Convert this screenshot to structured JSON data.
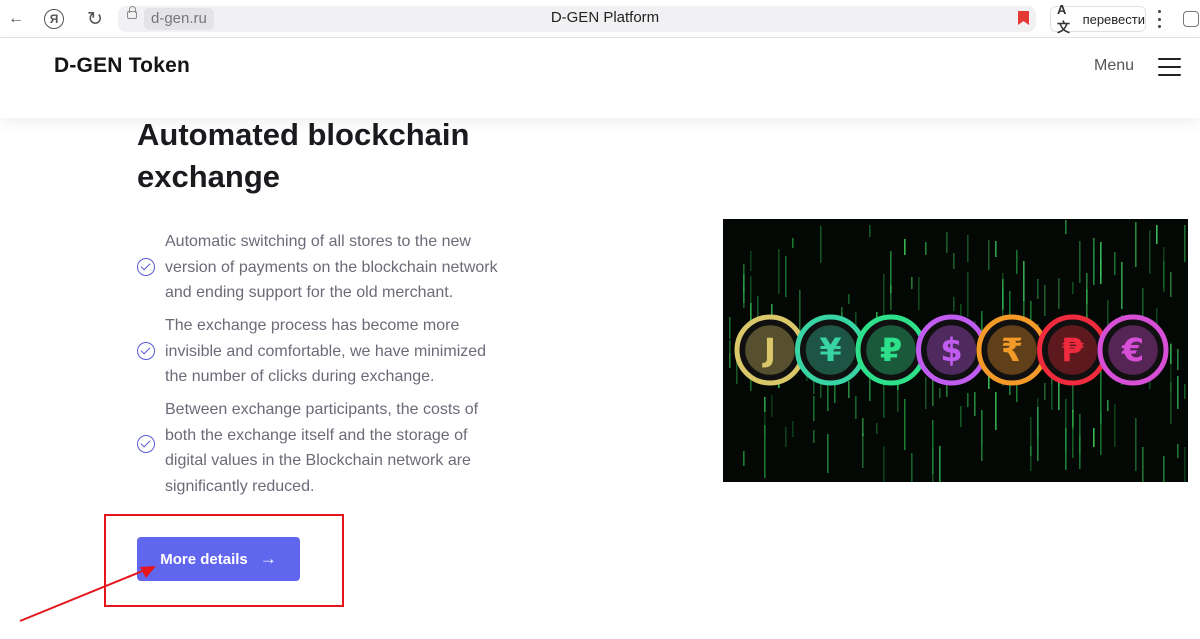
{
  "browser": {
    "url_domain": "d-gen.ru",
    "tab_title": "D-GEN Platform",
    "translate_label": "перевести",
    "translate_glyph": "A文",
    "back_glyph": "←",
    "reload_glyph": "↻",
    "yandex_glyph": "Я"
  },
  "header": {
    "logo": "D-GEN Token",
    "menu_label": "Menu"
  },
  "main": {
    "heading_line1": "Automated blockchain",
    "heading_line2": "exchange",
    "features": [
      {
        "line1": "Automatic switching of all stores to the new",
        "line2": "version of payments on the blockchain network",
        "line3": "and ending support for the old merchant."
      },
      {
        "line1": "The exchange process has become more",
        "line2": "invisible and comfortable, we have minimized",
        "line3": "the number of clicks during exchange."
      },
      {
        "line1": "Between exchange participants, the costs of",
        "line2": "both the exchange itself and the storage of",
        "line3": "digital values in the Blockchain network are",
        "line4": "significantly reduced."
      }
    ],
    "cta_label": "More details",
    "cta_arrow": "→"
  },
  "hero_image": {
    "coins": [
      {
        "glyph": "J",
        "color": "#d9c76a"
      },
      {
        "glyph": "¥",
        "color": "#39d4a4"
      },
      {
        "glyph": "₽",
        "color": "#2ee08a"
      },
      {
        "glyph": "$",
        "color": "#c15cf0"
      },
      {
        "glyph": "₹",
        "color": "#f39a28"
      },
      {
        "glyph": "₱",
        "color": "#ef2b3d"
      },
      {
        "glyph": "€",
        "color": "#d64fd6"
      }
    ]
  },
  "colors": {
    "accent": "#6166ef",
    "check": "#5b5bd6",
    "annotation": "#e5161b"
  }
}
